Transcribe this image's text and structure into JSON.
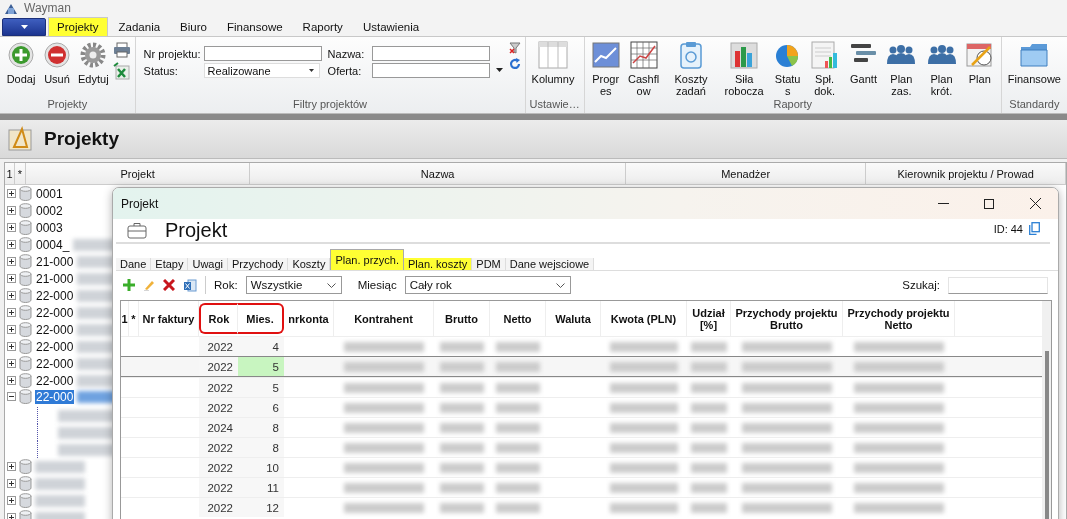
{
  "window": {
    "title": "Wayman"
  },
  "ribbon": {
    "tabs": [
      {
        "label": "Projekty",
        "selected": true,
        "highlighted": true
      },
      {
        "label": "Zadania",
        "selected": false,
        "highlighted": false
      },
      {
        "label": "Biuro",
        "selected": false,
        "highlighted": false
      },
      {
        "label": "Finansowe",
        "selected": false,
        "highlighted": false
      },
      {
        "label": "Raporty",
        "selected": false,
        "highlighted": false
      },
      {
        "label": "Ustawienia",
        "selected": false,
        "highlighted": false
      }
    ],
    "projekty_group": {
      "label": "Projekty",
      "buttons": [
        "Dodaj",
        "Usuń",
        "Edytuj"
      ]
    },
    "filters_group": {
      "label": "Filtry projektów",
      "nr_projektu": {
        "label": "Nr projektu:"
      },
      "status": {
        "label": "Status:",
        "value": "Realizowane"
      },
      "nazwa": {
        "label": "Nazwa:"
      },
      "oferta": {
        "label": "Oferta:"
      }
    },
    "settings_group": {
      "label": "Ustawie…",
      "buttons": [
        "Kolumny"
      ]
    },
    "reports_group": {
      "label": "Raporty",
      "buttons": [
        "Progres",
        "Cashflow",
        "Koszty zadań",
        "Siła robocza",
        "Status",
        "Spł. dok.",
        "Gantt",
        "Plan zas.",
        "Plan krót.",
        "Plan"
      ]
    },
    "standards_group": {
      "label": "Standardy",
      "buttons": [
        "Finansowe"
      ]
    }
  },
  "page": {
    "title": "Projekty"
  },
  "projects": {
    "columns": [
      "1",
      "*",
      "Projekt",
      "Nazwa",
      "Menadżer",
      "Kierownik projektu / Prowad"
    ],
    "rows": [
      {
        "label": "0001",
        "expanded": false,
        "selected": false,
        "redacted": false
      },
      {
        "label": "0002",
        "expanded": false,
        "selected": false,
        "redacted": false
      },
      {
        "label": "0003",
        "expanded": false,
        "selected": false,
        "redacted": false
      },
      {
        "label": "0004_",
        "expanded": false,
        "selected": false,
        "redacted": true
      },
      {
        "label": "21-000",
        "expanded": false,
        "selected": false,
        "redacted": true
      },
      {
        "label": "21-000",
        "expanded": false,
        "selected": false,
        "redacted": true
      },
      {
        "label": "22-000",
        "expanded": false,
        "selected": false,
        "redacted": true
      },
      {
        "label": "22-000",
        "expanded": false,
        "selected": false,
        "redacted": true
      },
      {
        "label": "22-000",
        "expanded": false,
        "selected": false,
        "redacted": true
      },
      {
        "label": "22-000",
        "expanded": false,
        "selected": false,
        "redacted": true
      },
      {
        "label": "22-000",
        "expanded": false,
        "selected": false,
        "redacted": true
      },
      {
        "label": "22-000",
        "expanded": false,
        "selected": false,
        "redacted": true
      },
      {
        "label": "22-000",
        "expanded": true,
        "selected": true,
        "redacted": true
      },
      {
        "expanded": false,
        "selected": false,
        "redacted": true
      },
      {
        "expanded": false,
        "selected": false,
        "redacted": true
      },
      {
        "expanded": false,
        "selected": false,
        "redacted": true
      },
      {
        "expanded": false,
        "selected": false,
        "redacted": true
      }
    ]
  },
  "dialog": {
    "title": "Projekt",
    "heading": "Projekt",
    "id": "ID: 44",
    "tabs": [
      {
        "label": "Dane",
        "selected": false,
        "highlighted": false
      },
      {
        "label": "Etapy",
        "selected": false,
        "highlighted": false
      },
      {
        "label": "Uwagi",
        "selected": false,
        "highlighted": false
      },
      {
        "label": "Przychody",
        "selected": false,
        "highlighted": false
      },
      {
        "label": "Koszty",
        "selected": false,
        "highlighted": false
      },
      {
        "label": "Plan. przych.",
        "selected": true,
        "highlighted": true
      },
      {
        "label": "Plan. koszty",
        "selected": false,
        "highlighted": true
      },
      {
        "label": "PDM",
        "selected": false,
        "highlighted": false
      },
      {
        "label": "Dane wejsciowe",
        "selected": false,
        "highlighted": false
      }
    ],
    "year_filter": {
      "label": "Rok:",
      "value": "Wszystkie"
    },
    "month_filter": {
      "label": "Miesiąc",
      "value": "Cały rok"
    },
    "search": {
      "label": "Szukaj:"
    },
    "columns": [
      {
        "label": "1",
        "outlined": false
      },
      {
        "label": "*",
        "outlined": false
      },
      {
        "label": "Nr faktury",
        "outlined": false
      },
      {
        "label": "Rok",
        "outlined": true
      },
      {
        "label": "Mies.",
        "outlined": true
      },
      {
        "label": "nrkonta",
        "outlined": false
      },
      {
        "label": "Kontrahent",
        "outlined": false
      },
      {
        "label": "Brutto",
        "outlined": false
      },
      {
        "label": "Netto",
        "outlined": false
      },
      {
        "label": "Waluta",
        "outlined": false
      },
      {
        "label": "Kwota (PLN)",
        "outlined": false
      },
      {
        "label": "Udział [%]",
        "outlined": false
      },
      {
        "label": "Przychody projektu Brutto",
        "outlined": false
      },
      {
        "label": "Przychody projektu Netto",
        "outlined": false
      }
    ],
    "rows": [
      {
        "year": "2022",
        "month": "4",
        "selected": false
      },
      {
        "year": "2022",
        "month": "5",
        "selected": true
      },
      {
        "year": "2022",
        "month": "5",
        "selected": false
      },
      {
        "year": "2022",
        "month": "6",
        "selected": false
      },
      {
        "year": "2024",
        "month": "8",
        "selected": false
      },
      {
        "year": "2022",
        "month": "8",
        "selected": false
      },
      {
        "year": "2022",
        "month": "10",
        "selected": false
      },
      {
        "year": "2022",
        "month": "11",
        "selected": false
      },
      {
        "year": "2022",
        "month": "12",
        "selected": false
      }
    ]
  }
}
